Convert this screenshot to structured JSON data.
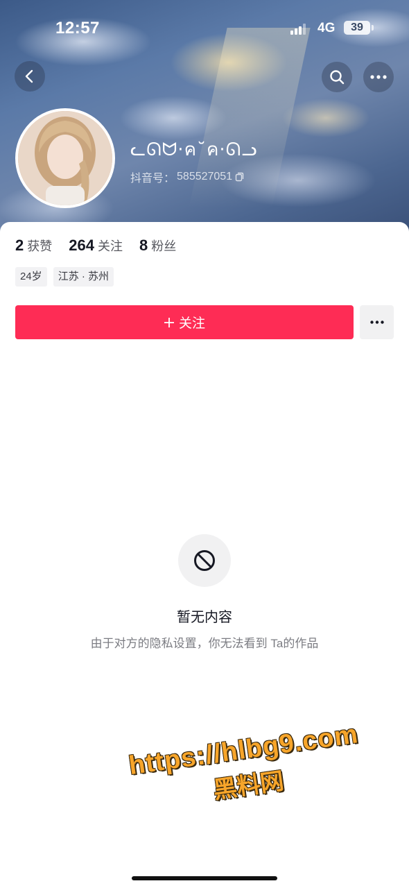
{
  "status_bar": {
    "time": "12:57",
    "network": "4G",
    "battery": "39"
  },
  "header": {
    "back_icon": "chevron-left-icon",
    "search_icon": "search-icon",
    "more_icon": "ellipsis-icon"
  },
  "profile": {
    "nickname": "ᓚᘏᗢ·ค˘ค·ᘏᓗ",
    "douyin_id_label": "抖音号：",
    "douyin_id": "585527051",
    "copy_icon": "copy-icon"
  },
  "stats": [
    {
      "value": "2",
      "label": "获赞"
    },
    {
      "value": "264",
      "label": "关注"
    },
    {
      "value": "8",
      "label": "粉丝"
    }
  ],
  "tags": [
    "24岁",
    "江苏 · 苏州"
  ],
  "actions": {
    "follow_label": "关注",
    "follow_icon": "plus-icon",
    "more_icon": "ellipsis-icon"
  },
  "empty_state": {
    "icon": "prohibited-icon",
    "title": "暂无内容",
    "description": "由于对方的隐私设置，你无法看到 Ta的作品"
  },
  "watermark": {
    "url": "https://hlbg9.com",
    "name": "黑料网"
  },
  "colors": {
    "accent": "#fe2c55",
    "text_primary": "#161823",
    "text_secondary": "#7b7c82"
  }
}
